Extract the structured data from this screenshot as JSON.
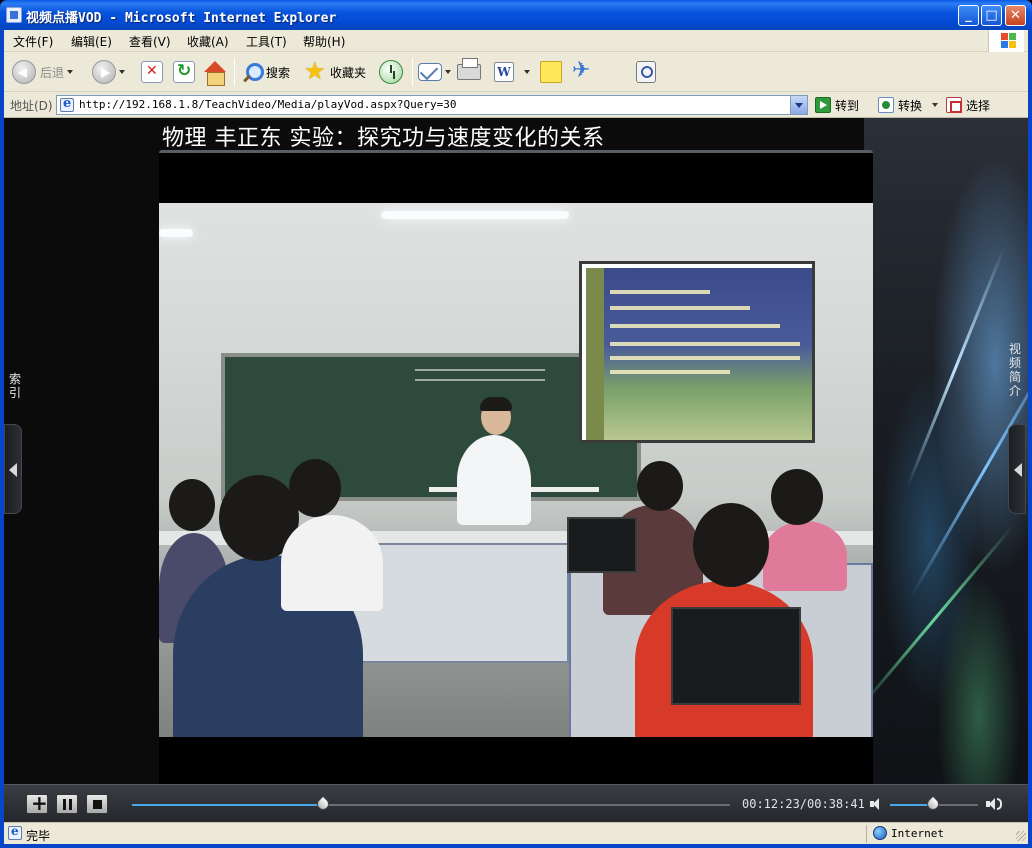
{
  "window": {
    "title": "视频点播VOD - Microsoft Internet Explorer",
    "min_glyph": "_",
    "max_glyph": "□",
    "close_glyph": "✕"
  },
  "menu": {
    "items": [
      {
        "label": "文件(F)"
      },
      {
        "label": "编辑(E)"
      },
      {
        "label": "查看(V)"
      },
      {
        "label": "收藏(A)"
      },
      {
        "label": "工具(T)"
      },
      {
        "label": "帮助(H)"
      }
    ]
  },
  "toolbar": {
    "back_label": "后退",
    "search_label": "搜索",
    "favorites_label": "收藏夹",
    "word_glyph": "W"
  },
  "address": {
    "label": "地址(D)",
    "url": "http://192.168.1.8/TeachVideo/Media/playVod.aspx?Query=30",
    "go_label": "转到",
    "convert_label": "转换",
    "select_label": "选择"
  },
  "player": {
    "title": "物理 丰正东 实验：探究功与速度变化的关系",
    "current_time": "00:12:23",
    "total_time": "00:38:41",
    "time_display": "00:12:23/00:38:41",
    "progress_fraction": 0.32,
    "volume_fraction": 0.49,
    "left_tab_label": "索引",
    "right_tab_label": "视频简介"
  },
  "status": {
    "text": "完毕",
    "zone": "Internet"
  },
  "colors": {
    "title_bar": "#0855dd",
    "chrome": "#ece9d8",
    "player_bg": "#0b0b0c",
    "progress_accent": "#4aa8e8"
  }
}
